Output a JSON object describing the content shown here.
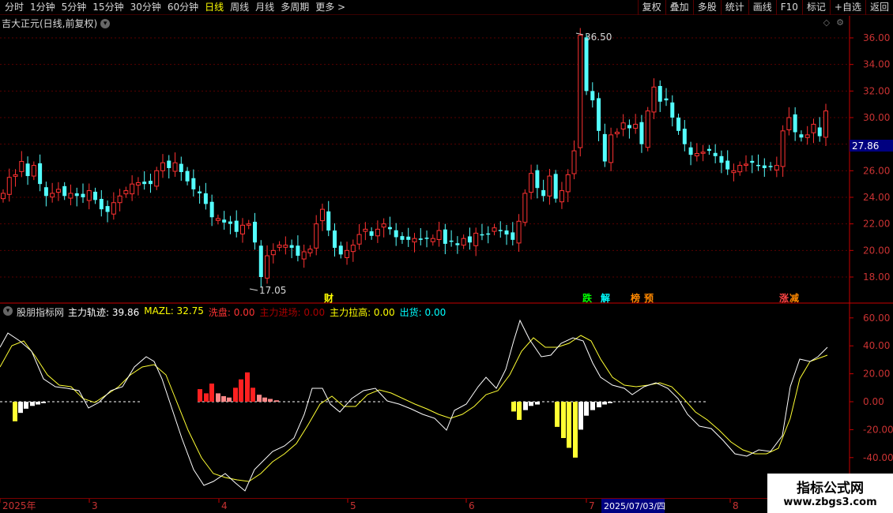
{
  "toolbar": {
    "periods": [
      "分时",
      "1分钟",
      "5分钟",
      "15分钟",
      "30分钟",
      "60分钟",
      "日线",
      "周线",
      "月线",
      "多周期",
      "更多 >"
    ],
    "active": "日线",
    "buttons": [
      "复权",
      "叠加",
      "多股",
      "统计",
      "画线",
      "F10",
      "标记",
      "+自选",
      "返回"
    ]
  },
  "stock_title": "吉大正元(日线,前复权)",
  "price_axis": {
    "ticks": [
      "36.00",
      "34.00",
      "32.00",
      "30.00",
      "28.00",
      "26.00",
      "24.00",
      "22.00",
      "20.00",
      "18.00"
    ],
    "current_price": "27.86"
  },
  "annotations": {
    "high": "36.50",
    "low": "17.05"
  },
  "events": [
    {
      "label": "财",
      "color": "#ffff00"
    },
    {
      "label": "跌",
      "color": "#00ff00"
    },
    {
      "label": "解",
      "color": "#00ffff"
    },
    {
      "label": "榜",
      "color": "#ff8800"
    },
    {
      "label": "预",
      "color": "#ff8800"
    },
    {
      "label": "涨",
      "color": "#ff4444"
    },
    {
      "label": "减",
      "color": "#ff8800"
    }
  ],
  "indicator": {
    "name": "股朋指标网",
    "fields": [
      {
        "label": "主力轨迹: 39.86",
        "color": "#ffffff"
      },
      {
        "label": "MAZL: 32.75",
        "color": "#ffff00"
      },
      {
        "label": "洗盘: 0.00",
        "color": "#ff3333"
      },
      {
        "label": "主力进场: 0.00",
        "color": "#aa0000"
      },
      {
        "label": "主力拉高: 0.00",
        "color": "#ffff00"
      },
      {
        "label": "出货: 0.00",
        "color": "#00ffff"
      }
    ],
    "axis_ticks": [
      "60.00",
      "40.00",
      "20.00",
      "0.00",
      "-20.00",
      "-40.00"
    ]
  },
  "date_axis": {
    "labels": [
      "2025年",
      "3",
      "4",
      "5",
      "6",
      "7",
      "8"
    ],
    "highlight": "2025/07/03/四"
  },
  "watermark": {
    "line1": "指标公式网",
    "line2": "www.zbgs3.com"
  },
  "colors": {
    "up": "#ff3232",
    "down": "#54ffff",
    "axis": "#c80000",
    "grid": "#5a0000"
  }
}
